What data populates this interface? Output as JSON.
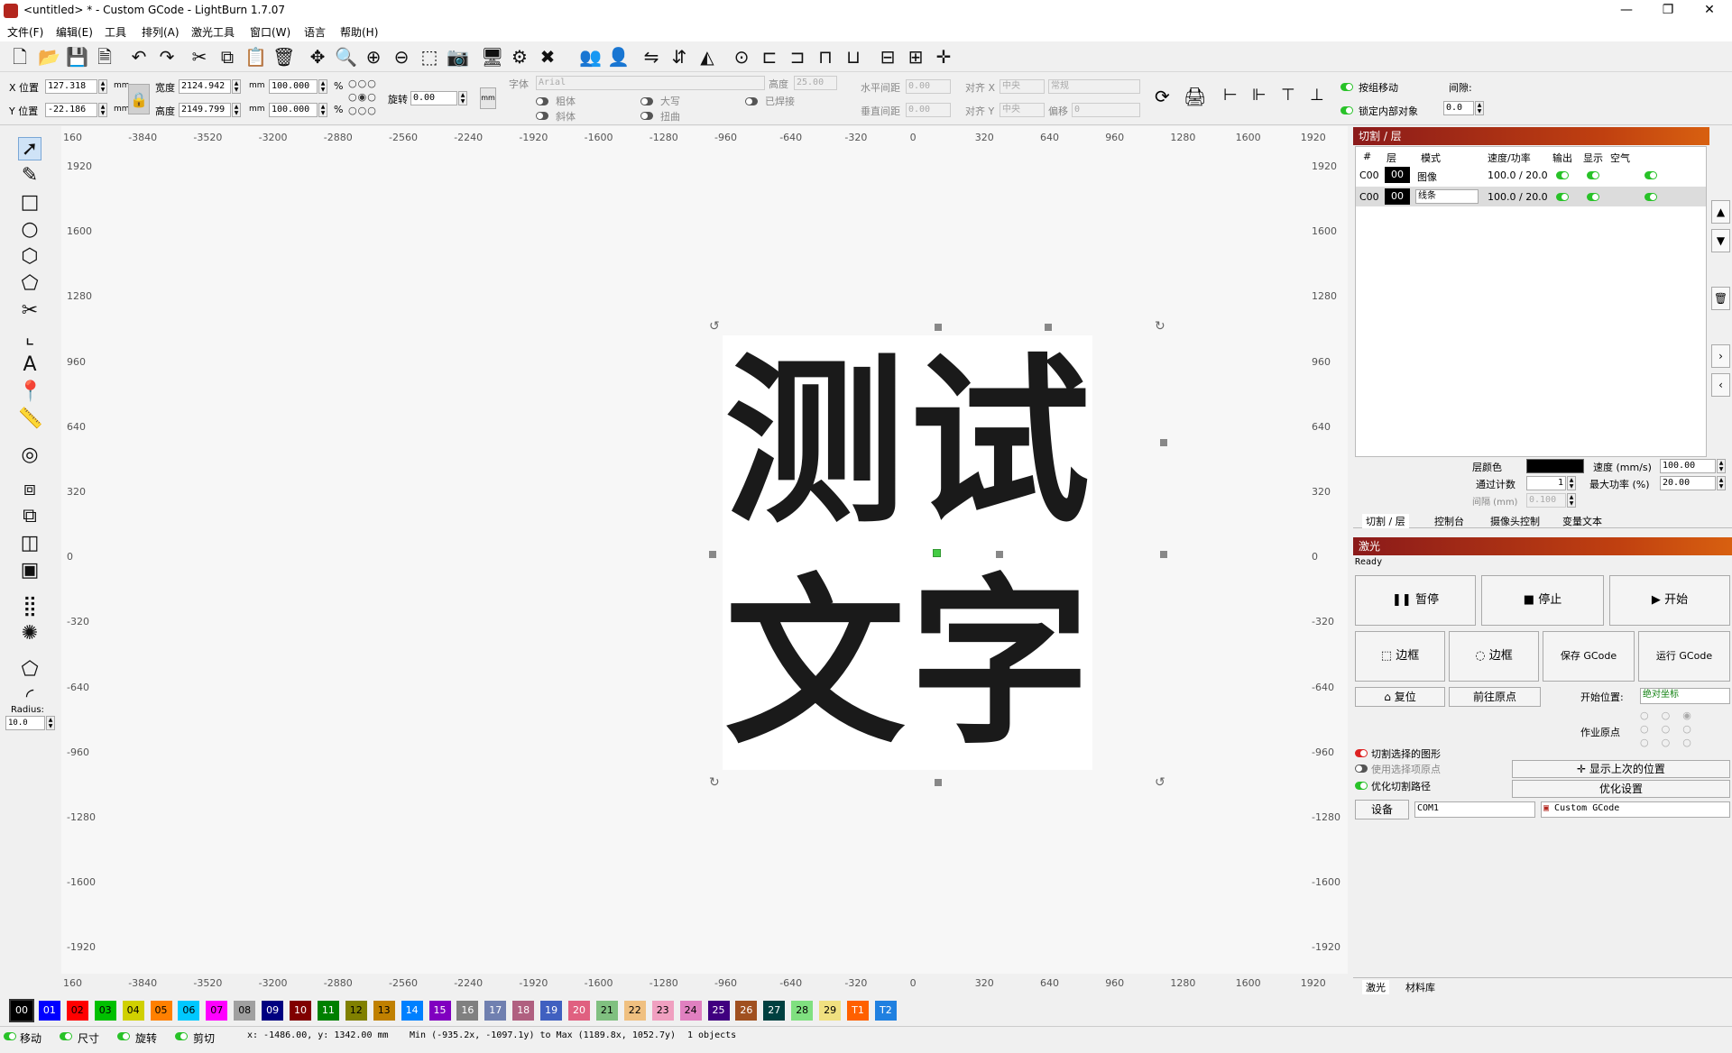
{
  "window": {
    "title": "<untitled> * - Custom GCode - LightBurn 1.7.07",
    "min": "—",
    "max": "❐",
    "close": "✕"
  },
  "menu": [
    "文件(F)",
    "编辑(E)",
    "工具",
    "排列(A)",
    "激光工具",
    "窗口(W)",
    "语言",
    "帮助(H)"
  ],
  "props": {
    "x_label": "X 位置",
    "x_value": "127.318",
    "y_label": "Y 位置",
    "y_value": "-22.186",
    "unit": "mm",
    "w_label": "宽度",
    "w_value": "2124.942",
    "h_label": "高度",
    "h_value": "2149.799",
    "w_pct": "100.000",
    "h_pct": "100.000",
    "pct": "%",
    "rot_label": "旋转",
    "rot_value": "0.00",
    "mm_btn": "mm",
    "font_label": "字体",
    "font_value": "Arial",
    "height_label": "高度",
    "height_value": "25.00",
    "hspace_label": "水平间距",
    "hspace_value": "0.00",
    "vspace_label": "垂直间距",
    "vspace_value": "0.00",
    "align_x_label": "对齐 X",
    "align_x_value": "中央",
    "align_y_label": "对齐 Y",
    "align_y_value": "中央",
    "style_value": "常规",
    "offset_label": "偏移",
    "offset_value": "0",
    "bold": "粗体",
    "italic": "斜体",
    "upper": "大写",
    "distort": "扭曲",
    "welded": "已焊接",
    "group_move": "按组移动",
    "lock_inner": "锁定内部对象",
    "gap_label": "间隙:",
    "gap_value": "0.0"
  },
  "left_tools": {
    "radius_label": "Radius:",
    "radius_value": "10.0"
  },
  "canvas": {
    "ruler_x": [
      "160",
      "-3840",
      "-3520",
      "-3200",
      "-2880",
      "-2560",
      "-2240",
      "-1920",
      "-1600",
      "-1280",
      "-960",
      "-640",
      "-320",
      "0",
      "320",
      "640",
      "960",
      "1280",
      "1600",
      "1920"
    ],
    "ruler_y": [
      "1920",
      "1600",
      "1280",
      "960",
      "640",
      "320",
      "0",
      "-320",
      "-640",
      "-960",
      "-1280",
      "-1600",
      "-1920"
    ],
    "chars": [
      "测",
      "试",
      "文",
      "字"
    ]
  },
  "cuts": {
    "title": "切割 / 层",
    "headers": [
      "#",
      "层",
      "模式",
      "速度/功率",
      "输出",
      "显示",
      "空气"
    ],
    "rows": [
      {
        "num": "C00",
        "layer": "00",
        "mode": "图像",
        "speed": "100.0 / 20.0"
      },
      {
        "num": "C00",
        "layer": "00",
        "mode": "线条",
        "speed": "100.0 / 20.0"
      }
    ],
    "layer_color_label": "层颜色",
    "speed_label": "速度 (mm/s)",
    "speed_value": "100.00",
    "passes_label": "通过计数",
    "passes_value": "1",
    "maxpower_label": "最大功率 (%)",
    "maxpower_value": "20.00",
    "interval_label": "间隔 (mm)",
    "interval_value": "0.100",
    "tabs": [
      "切割 / 层",
      "控制台",
      "摄像头控制",
      "变量文本"
    ]
  },
  "laser": {
    "title": "激光",
    "status": "Ready",
    "pause": "暂停",
    "stop": "停止",
    "start": "开始",
    "frame1": "边框",
    "frame2": "边框",
    "save_gcode": "保存 GCode",
    "run_gcode": "运行 GCode",
    "home": "复位",
    "goto_origin": "前往原点",
    "start_from_label": "开始位置:",
    "start_from_value": "绝对坐标",
    "job_origin_label": "作业原点",
    "cut_selected": "切割选择的图形",
    "use_selection_origin": "使用选择项原点",
    "optimize_cut": "优化切割路径",
    "show_last_pos": "显示上次的位置",
    "optimize_settings": "优化设置",
    "device_btn": "设备",
    "port_value": "COM1",
    "device_value": "Custom GCode",
    "tabs": [
      "激光",
      "材料库"
    ]
  },
  "palette": [
    {
      "l": "00",
      "c": "#000000",
      "t": "#ffffff"
    },
    {
      "l": "01",
      "c": "#0000ff",
      "t": "#ffffff"
    },
    {
      "l": "02",
      "c": "#ff0000",
      "t": "#000000"
    },
    {
      "l": "03",
      "c": "#00c000",
      "t": "#000000"
    },
    {
      "l": "04",
      "c": "#d0d000",
      "t": "#000000"
    },
    {
      "l": "05",
      "c": "#ff8000",
      "t": "#000000"
    },
    {
      "l": "06",
      "c": "#00c8ff",
      "t": "#000000"
    },
    {
      "l": "07",
      "c": "#ff00ff",
      "t": "#000000"
    },
    {
      "l": "08",
      "c": "#a0a0a0",
      "t": "#000000"
    },
    {
      "l": "09",
      "c": "#000080",
      "t": "#ffffff"
    },
    {
      "l": "10",
      "c": "#800000",
      "t": "#ffffff"
    },
    {
      "l": "11",
      "c": "#008000",
      "t": "#ffffff"
    },
    {
      "l": "12",
      "c": "#808000",
      "t": "#000000"
    },
    {
      "l": "13",
      "c": "#c08000",
      "t": "#000000"
    },
    {
      "l": "14",
      "c": "#0080ff",
      "t": "#ffffff"
    },
    {
      "l": "15",
      "c": "#8000c0",
      "t": "#ffffff"
    },
    {
      "l": "16",
      "c": "#808080",
      "t": "#ffffff"
    },
    {
      "l": "17",
      "c": "#7080b0",
      "t": "#ffffff"
    },
    {
      "l": "18",
      "c": "#b06080",
      "t": "#ffffff"
    },
    {
      "l": "19",
      "c": "#4060c0",
      "t": "#ffffff"
    },
    {
      "l": "20",
      "c": "#e06080",
      "t": "#ffffff"
    },
    {
      "l": "21",
      "c": "#80c080",
      "t": "#000000"
    },
    {
      "l": "22",
      "c": "#f0c080",
      "t": "#000000"
    },
    {
      "l": "23",
      "c": "#f0a0c0",
      "t": "#000000"
    },
    {
      "l": "24",
      "c": "#e080c0",
      "t": "#000000"
    },
    {
      "l": "25",
      "c": "#400080",
      "t": "#ffffff"
    },
    {
      "l": "26",
      "c": "#a05020",
      "t": "#ffffff"
    },
    {
      "l": "27",
      "c": "#004040",
      "t": "#ffffff"
    },
    {
      "l": "28",
      "c": "#80e080",
      "t": "#000000"
    },
    {
      "l": "29",
      "c": "#f0e080",
      "t": "#000000"
    },
    {
      "l": "T1",
      "c": "#ff6000",
      "t": "#ffffff"
    },
    {
      "l": "T2",
      "c": "#2080e0",
      "t": "#ffffff"
    }
  ],
  "status": {
    "move": "移动",
    "size": "尺寸",
    "rotate": "旋转",
    "shear": "剪切",
    "coords": "x: -1486.00, y: 1342.00 mm",
    "minmax": "Min (-935.2x, -1097.1y) to Max (1189.8x, 1052.7y)",
    "objects": "1 objects"
  }
}
